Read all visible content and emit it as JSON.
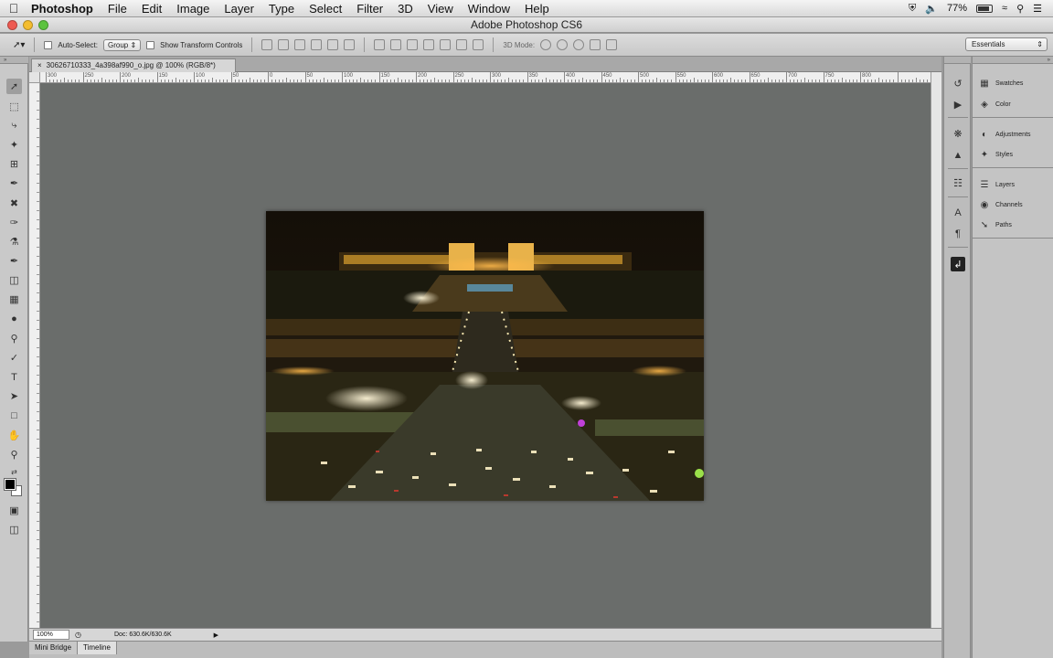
{
  "menubar": {
    "app": "Photoshop",
    "items": [
      "File",
      "Edit",
      "Image",
      "Layer",
      "Type",
      "Select",
      "Filter",
      "3D",
      "View",
      "Window",
      "Help"
    ],
    "battery": "77%"
  },
  "window": {
    "title": "Adobe Photoshop CS6"
  },
  "options": {
    "auto_select_label": "Auto-Select:",
    "group_value": "Group",
    "transform_label": "Show Transform Controls",
    "mode_3d": "3D Mode:",
    "workspace": "Essentials"
  },
  "document": {
    "tab_label": "30626710333_4a398af990_o.jpg @ 100% (RGB/8*)",
    "zoom": "100%",
    "doc_size": "Doc: 630.6K/630.6K"
  },
  "ruler": {
    "top": [
      "300",
      "250",
      "200",
      "150",
      "100",
      "50",
      "0",
      "50",
      "100",
      "150",
      "200",
      "250",
      "300",
      "350",
      "400",
      "450",
      "500",
      "550",
      "600",
      "650",
      "700",
      "750",
      "800"
    ]
  },
  "bottom_tabs": [
    "Mini Bridge",
    "Timeline"
  ],
  "panels": {
    "group1": [
      "Swatches",
      "Color"
    ],
    "group2": [
      "Adjustments",
      "Styles"
    ],
    "group3": [
      "Layers",
      "Channels",
      "Paths"
    ]
  }
}
